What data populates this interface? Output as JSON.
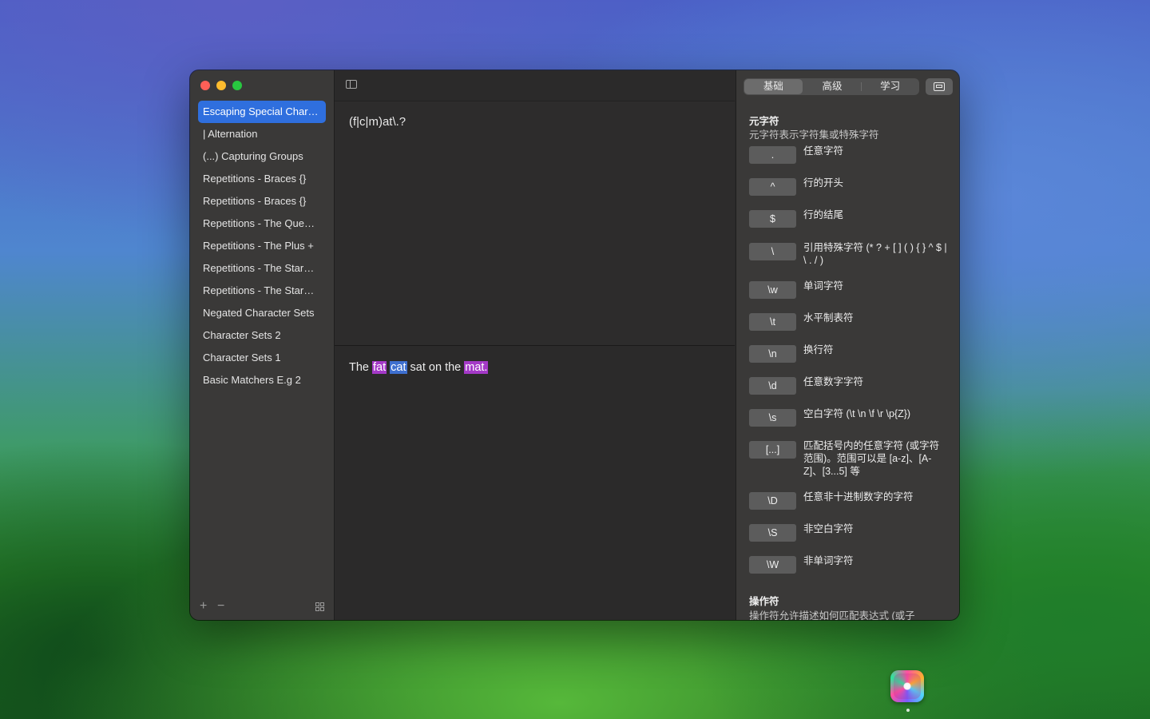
{
  "sidebar": {
    "items": [
      {
        "label": "Escaping Special Char…",
        "selected": true
      },
      {
        "label": "| Alternation"
      },
      {
        "label": "(...) Capturing Groups"
      },
      {
        "label": "Repetitions - Braces {}"
      },
      {
        "label": "Repetitions - Braces {}"
      },
      {
        "label": "Repetitions - The Que…"
      },
      {
        "label": "Repetitions - The Plus +"
      },
      {
        "label": "Repetitions - The Star…"
      },
      {
        "label": "Repetitions - The Star…"
      },
      {
        "label": "Negated Character Sets"
      },
      {
        "label": "Character Sets 2"
      },
      {
        "label": "Character Sets 1"
      },
      {
        "label": "Basic Matchers E.g  2"
      }
    ],
    "add_label": "+",
    "remove_label": "−"
  },
  "editor": {
    "pattern": "(f|c|m)at\\.?",
    "test": {
      "t1": "The ",
      "m1": "fat",
      "t2": " ",
      "m2": "cat",
      "t3": " sat on the ",
      "m3": "mat."
    }
  },
  "reference": {
    "tabs": [
      "基础",
      "高级",
      "学习"
    ],
    "active_tab": "基础",
    "section1": {
      "title": "元字符",
      "subtitle": "元字符表示字符集或特殊字符"
    },
    "entries": [
      {
        "key": ".",
        "desc": "任意字符"
      },
      {
        "key": "^",
        "desc": "行的开头"
      },
      {
        "key": "$",
        "desc": "行的结尾"
      },
      {
        "key": "\\",
        "desc": "引用特殊字符 (* ? + [ ] ( ) { } ^ $ | \\ . / )"
      },
      {
        "key": "\\w",
        "desc": "单词字符"
      },
      {
        "key": "\\t",
        "desc": "水平制表符"
      },
      {
        "key": "\\n",
        "desc": "换行符"
      },
      {
        "key": "\\d",
        "desc": "任意数字字符"
      },
      {
        "key": "\\s",
        "desc": "空白字符 (\\t \\n \\f \\r \\p{Z})"
      },
      {
        "key": "[...]",
        "desc": "匹配括号内的任意字符 (或字符范围)。范围可以是 [a-z]、[A-Z]、[3...5] 等"
      },
      {
        "key": "\\D",
        "desc": "任意非十进制数字的字符"
      },
      {
        "key": "\\S",
        "desc": "非空白字符"
      },
      {
        "key": "\\W",
        "desc": "非单词字符"
      }
    ],
    "section2": {
      "title": "操作符",
      "subtitle": "操作符允许描述如何匹配表达式 (或子"
    }
  },
  "colors": {
    "selection": "#2f6fde",
    "match_purple": "#a439c7",
    "match_blue": "#3e6fcf"
  }
}
